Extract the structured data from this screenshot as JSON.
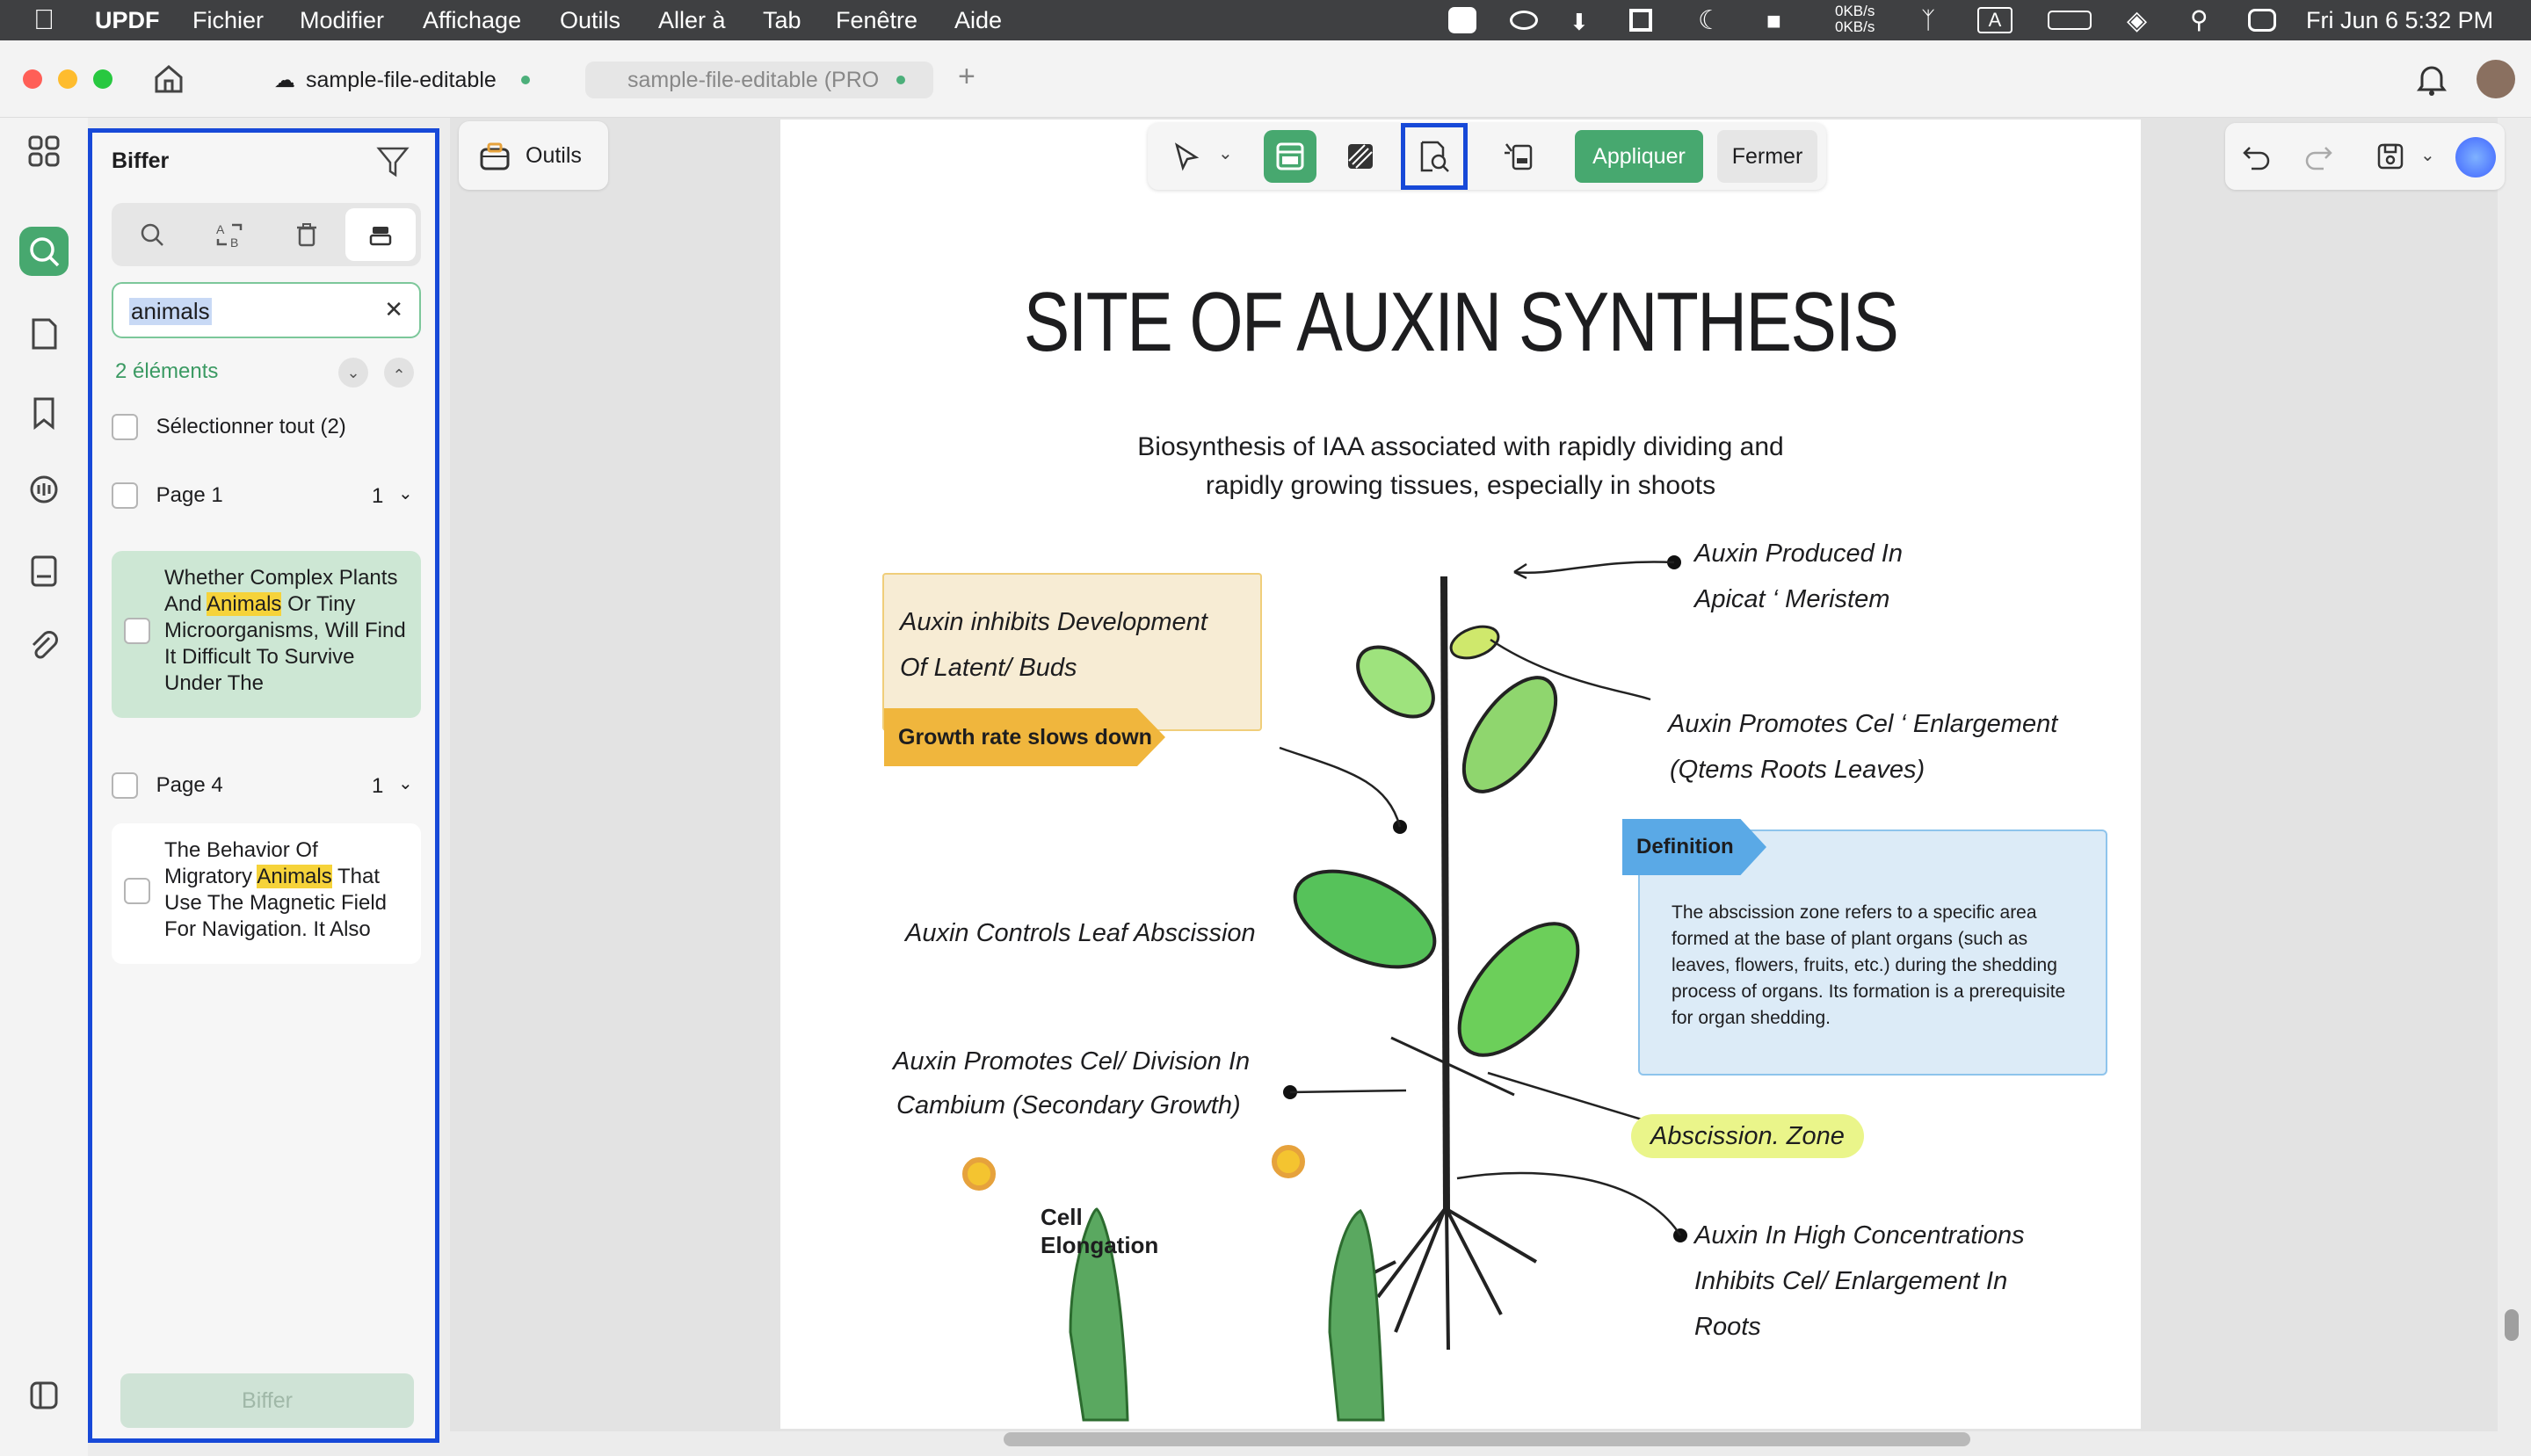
{
  "menubar": {
    "app": "UPDF",
    "items": [
      "Fichier",
      "Modifier",
      "Affichage",
      "Outils",
      "Aller à",
      "Tab",
      "Fenêtre",
      "Aide"
    ],
    "net_up": "0KB/s",
    "net_down": "0KB/s",
    "input_indicator": "A",
    "datetime": "Fri Jun 6  5:32 PM"
  },
  "tabs": [
    {
      "label": "sample-file-editable"
    },
    {
      "label": "sample-file-editable (PRO"
    }
  ],
  "toolbox": {
    "label": "Outils"
  },
  "panel": {
    "title": "Biffer",
    "search_value": "animals",
    "count": "2 éléments",
    "select_all": "Sélectionner tout  (2)",
    "pages": [
      {
        "label": "Page 1",
        "count": "1",
        "snippet": {
          "before": "Whether Complex Plants And ",
          "match": "Animals",
          "after": " Or Tiny Microorganisms, Will Find It Difficult To Survive Under The"
        }
      },
      {
        "label": "Page 4",
        "count": "1",
        "snippet": {
          "before": "The Behavior Of Migratory ",
          "match": "Animals",
          "after": " That Use The Magnetic Field For Navigation. It Also"
        }
      }
    ],
    "action": "Biffer"
  },
  "redact_toolbar": {
    "apply": "Appliquer",
    "close": "Fermer"
  },
  "document": {
    "title": "SITE OF AUXIN SYNTHESIS",
    "subtitle_line1": "Biosynthesis of IAA associated with rapidly dividing and",
    "subtitle_line2": "rapidly growing tissues, especially in shoots",
    "produced_1": "Auxin Produced In",
    "produced_2": "Apicat ‘ Meristem",
    "inhibits_1": "Auxin inhibits Development",
    "inhibits_2": "Of Latent/ Buds",
    "growth_tag": "Growth rate slows down",
    "promotes_1": "Auxin Promotes Cel ‘ Enlargement",
    "promotes_2": "(Qtems Roots Leaves)",
    "definition_tag": "Definition",
    "definition_text": "The abscission zone refers to a specific area formed at the base of plant organs (such as leaves, flowers, fruits, etc.) during the shedding process of organs. Its formation is a prerequisite for organ shedding.",
    "controls": "Auxin Controls Leaf Abscission",
    "division_1": "Auxin Promotes Cel/ Division In",
    "division_2": "Cambium (Secondary Growth)",
    "zone": "Abscission. Zone",
    "cell_1": "Cell",
    "cell_2": "Elongation",
    "high_1": "Auxin In High Concentrations",
    "high_2": "Inhibits Cel/ Enlargement In",
    "high_3": "Roots"
  },
  "colors": {
    "accent": "#47a86f",
    "highlight": "#f6d33a",
    "selection": "#1749d8",
    "growth_tag": "#f0b63d",
    "definition_tag": "#5aa9e6"
  }
}
